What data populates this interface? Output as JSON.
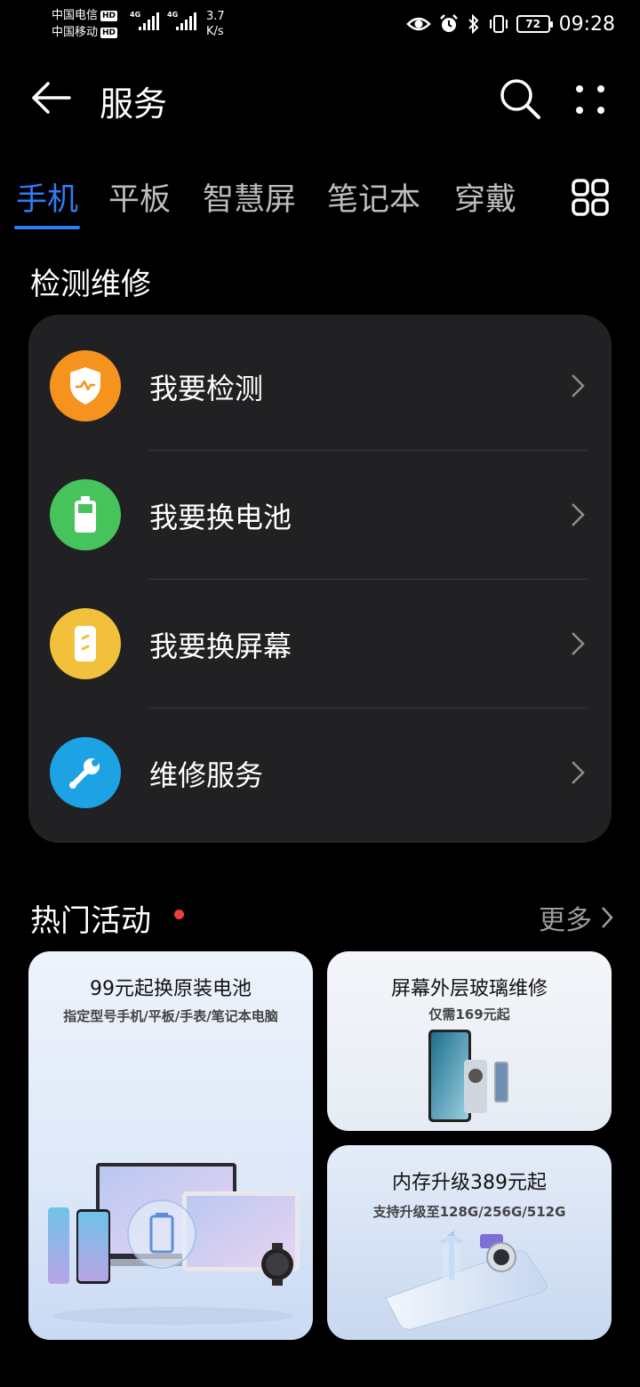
{
  "status": {
    "carrier1": "中国电信",
    "carrier2": "中国移动",
    "hd": "HD",
    "net": "4G",
    "speed_value": "3.7",
    "speed_unit": "K/s",
    "battery": "72",
    "time": "09:28"
  },
  "header": {
    "title": "服务"
  },
  "tabs": [
    "手机",
    "平板",
    "智慧屏",
    "笔记本",
    "穿戴"
  ],
  "repair": {
    "section_title": "检测维修",
    "items": [
      {
        "label": "我要检测",
        "icon": "shield-diagnose-icon",
        "color": "#f5931e"
      },
      {
        "label": "我要换电池",
        "icon": "battery-icon",
        "color": "#46c35a"
      },
      {
        "label": "我要换屏幕",
        "icon": "phone-screen-icon",
        "color": "#f2c03a"
      },
      {
        "label": "维修服务",
        "icon": "wrench-icon",
        "color": "#1da3e4"
      }
    ]
  },
  "hot": {
    "title": "热门活动",
    "more": "更多",
    "promos": [
      {
        "title": "99元起换原装电池",
        "subtitle": "指定型号手机/平板/手表/笔记本电脑"
      },
      {
        "title": "屏幕外层玻璃维修",
        "subtitle": "仅需169元起"
      },
      {
        "title": "内存升级389元起",
        "subtitle": "支持升级至128G/256G/512G"
      }
    ]
  },
  "colors": {
    "accent": "#2f7cf6",
    "card": "#212123",
    "background": "#000000"
  }
}
